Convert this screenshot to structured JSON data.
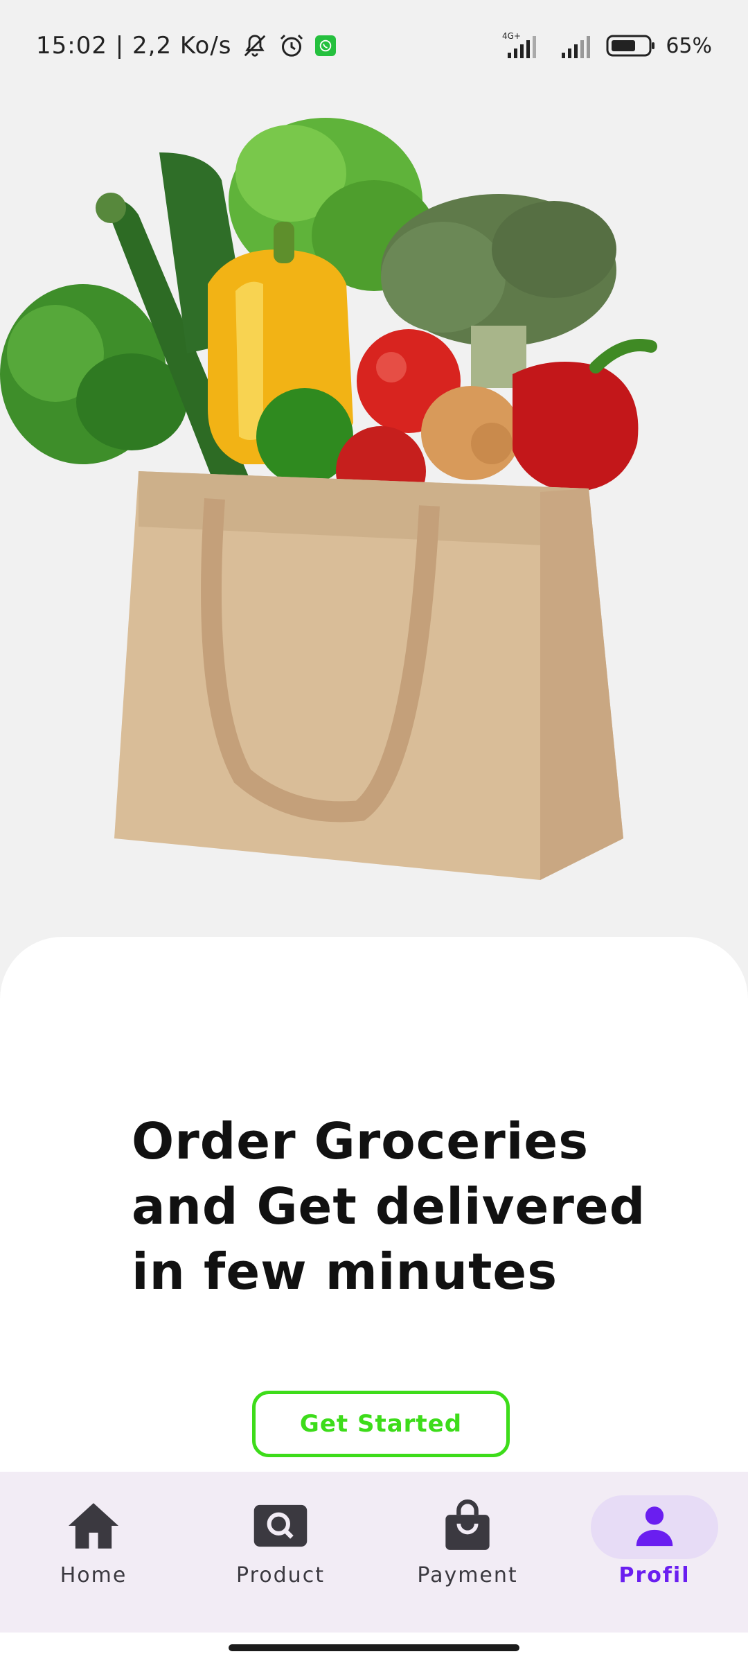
{
  "status_bar": {
    "time_speed": "15:02 | 2,2 Ko/s",
    "network_label": "4G+",
    "battery": "65%",
    "icons": [
      "bell-off-icon",
      "alarm-icon",
      "whatsapp-icon",
      "signal-icon",
      "battery-icon"
    ]
  },
  "hero": {
    "image": "grocery-bag-with-vegetables"
  },
  "main": {
    "headline": "Order Groceries and Get delivered in few minutes",
    "cta_label": "Get Started"
  },
  "bottom_nav": {
    "items": [
      {
        "label": "Home",
        "icon": "home-icon",
        "active": false
      },
      {
        "label": "Product",
        "icon": "search-icon",
        "active": false
      },
      {
        "label": "Payment",
        "icon": "shopping-bag-icon",
        "active": false
      },
      {
        "label": "Profil",
        "icon": "person-icon",
        "active": true
      }
    ]
  },
  "colors": {
    "accent_green": "#3ddc1a",
    "active_purple": "#6a1ef0",
    "nav_background": "#f2ecf5",
    "active_pill": "#e7dcf6"
  }
}
